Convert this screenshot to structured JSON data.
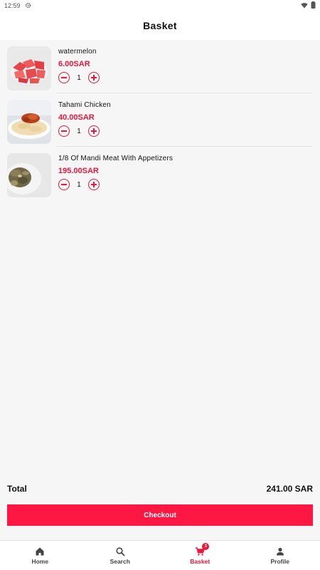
{
  "status_bar": {
    "time": "12:59"
  },
  "header": {
    "title": "Basket"
  },
  "items": [
    {
      "name": "watermelon",
      "price": "6.00SAR",
      "quantity": "1",
      "image": "watermelon"
    },
    {
      "name": "Tahami Chicken",
      "price": "40.00SAR",
      "quantity": "1",
      "image": "chicken-rice"
    },
    {
      "name": "1/8 Of Mandi Meat With Appetizers",
      "price": "195.00SAR",
      "quantity": "1",
      "image": "mandi-meat"
    }
  ],
  "summary": {
    "total_label": "Total",
    "total_value": "241.00 SAR"
  },
  "checkout_label": "Checkout",
  "nav": {
    "home": "Home",
    "search": "Search",
    "basket": "Basket",
    "basket_badge": "3",
    "profile": "Profile"
  },
  "colors": {
    "accent": "#e8173b",
    "button": "#ff1744"
  }
}
